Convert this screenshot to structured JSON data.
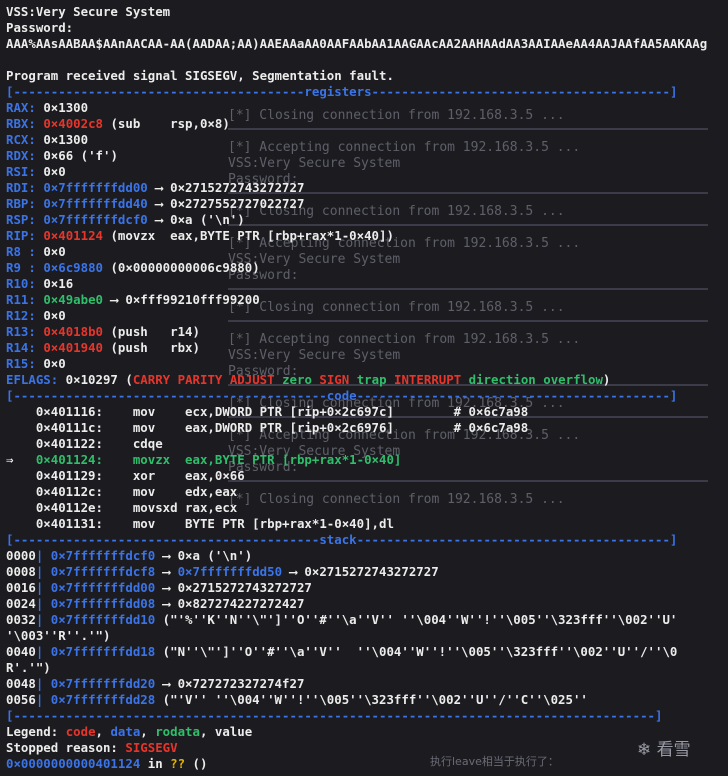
{
  "header": {
    "title": "VSS:Very Secure System",
    "password_label": "Password:",
    "password_input": "AAA%AAsAABAA$AAnAACAA-AA(AADAA;AA)AAEAAaAA0AAFAAbAA1AAGAAcAA2AAHAAdAA3AAIAAeAA4AAJAAfAA5AAKAAg",
    "signal": "Program received signal SIGSEGV, Segmentation fault."
  },
  "sections": {
    "registers": "registers",
    "code": "code",
    "stack": "stack"
  },
  "registers": [
    {
      "name": "RAX:",
      "value": "0×1300",
      "color": "white",
      "rest": ""
    },
    {
      "name": "RBX:",
      "value": "0×4002c8",
      "color": "red",
      "rest": " (sub    rsp,0×8)"
    },
    {
      "name": "RCX:",
      "value": "0×1300",
      "color": "white",
      "rest": ""
    },
    {
      "name": "RDX:",
      "value": "0×66 ('f')",
      "color": "white",
      "rest": ""
    },
    {
      "name": "RSI:",
      "value": "0×0",
      "color": "white",
      "rest": ""
    },
    {
      "name": "RDI:",
      "value": "0×7fffffffdd00",
      "color": "blue",
      "rest": " ⟶ 0×2715272743272727"
    },
    {
      "name": "RBP:",
      "value": "0×7fffffffdd40",
      "color": "blue",
      "rest": " ⟶ 0×2727552727022727"
    },
    {
      "name": "RSP:",
      "value": "0×7fffffffdcf0",
      "color": "blue",
      "rest": " ⟶ 0×a ('\\n')"
    },
    {
      "name": "RIP:",
      "value": "0×401124",
      "color": "red",
      "rest": " (movzx  eax,BYTE PTR [rbp+rax*1-0×40])"
    },
    {
      "name": "R8 :",
      "value": "0×0",
      "color": "white",
      "rest": ""
    },
    {
      "name": "R9 :",
      "value": "0×6c9880",
      "color": "blue",
      "rest": " (0×00000000006c9880)"
    },
    {
      "name": "R10:",
      "value": "0×16",
      "color": "white",
      "rest": ""
    },
    {
      "name": "R11:",
      "value": "0×49abe0",
      "color": "green",
      "rest": " ⟶ 0×fff99210fff99200"
    },
    {
      "name": "R12:",
      "value": "0×0",
      "color": "white",
      "rest": ""
    },
    {
      "name": "R13:",
      "value": "0×4018b0",
      "color": "red",
      "rest": " (push   r14)"
    },
    {
      "name": "R14:",
      "value": "0×401940",
      "color": "red",
      "rest": " (push   rbx)"
    },
    {
      "name": "R15:",
      "value": "0×0",
      "color": "white",
      "rest": ""
    }
  ],
  "eflags": {
    "label": "EFLAGS:",
    "value": "0×10297",
    "flags": [
      {
        "text": "CARRY",
        "color": "red"
      },
      {
        "text": "PARITY",
        "color": "red"
      },
      {
        "text": "ADJUST",
        "color": "red"
      },
      {
        "text": "zero",
        "color": "green"
      },
      {
        "text": "SIGN",
        "color": "red"
      },
      {
        "text": "trap",
        "color": "green"
      },
      {
        "text": "INTERRUPT",
        "color": "red"
      },
      {
        "text": "direction",
        "color": "green"
      },
      {
        "text": "overflow",
        "color": "green"
      }
    ]
  },
  "code": [
    {
      "marker": "  ",
      "addr": "0×401116:",
      "op": "mov   ",
      "args": "ecx,DWORD PTR [rip+0×2c697c]",
      "comment": "        # 0×6c7a98",
      "current": false
    },
    {
      "marker": "  ",
      "addr": "0×40111c:",
      "op": "mov   ",
      "args": "eax,DWORD PTR [rip+0×2c6976]",
      "comment": "        # 0×6c7a98",
      "current": false
    },
    {
      "marker": "  ",
      "addr": "0×401122:",
      "op": "cdqe  ",
      "args": "",
      "comment": "",
      "current": false
    },
    {
      "marker": "⇒ ",
      "addr": "0×401124:",
      "op": "movzx ",
      "args": "eax,BYTE PTR [rbp+rax*1-0×40]",
      "comment": "",
      "current": true
    },
    {
      "marker": "  ",
      "addr": "0×401129:",
      "op": "xor   ",
      "args": "eax,0×66",
      "comment": "",
      "current": false
    },
    {
      "marker": "  ",
      "addr": "0×40112c:",
      "op": "mov   ",
      "args": "edx,eax",
      "comment": "",
      "current": false
    },
    {
      "marker": "  ",
      "addr": "0×40112e:",
      "op": "movsxd",
      "args": "rax,ecx",
      "comment": "",
      "current": false
    },
    {
      "marker": "  ",
      "addr": "0×401131:",
      "op": "mov   ",
      "args": "BYTE PTR [rbp+rax*1-0×40],dl",
      "comment": "",
      "current": false
    }
  ],
  "stack": [
    {
      "off": "0000",
      "addr": "0×7fffffffdcf0",
      "rest": " ⟶ 0×a ('\\n')",
      "blue2": ""
    },
    {
      "off": "0008",
      "addr": "0×7fffffffdcf8",
      "rest": " ⟶ ",
      "blue2": "0×7fffffffdd50",
      "rest2": " ⟶ 0×2715272743272727"
    },
    {
      "off": "0016",
      "addr": "0×7fffffffdd00",
      "rest": " ⟶ 0×2715272743272727",
      "blue2": ""
    },
    {
      "off": "0024",
      "addr": "0×7fffffffdd08",
      "rest": " ⟶ 0×827274227272427",
      "blue2": ""
    },
    {
      "off": "0032",
      "addr": "0×7fffffffdd10",
      "rest": " (\"'%''K''N''\\\"']''O''#''\\a''V'' ''\\004''W''!''\\005''\\323fff''\\002''U'",
      "blue2": ""
    },
    {
      "off": "    ",
      "addr": "",
      "rest": "'\\003''R''.'\")",
      "blue2": "",
      "cont": true
    },
    {
      "off": "0040",
      "addr": "0×7fffffffdd18",
      "rest": " (\"N''\\\"']''O''#''\\a''V''  ''\\004''W''!''\\005''\\323fff''\\002''U''/''\\0",
      "blue2": ""
    },
    {
      "off": "    ",
      "addr": "",
      "rest": "R'.'\")",
      "blue2": "",
      "cont": true
    },
    {
      "off": "0048",
      "addr": "0×7fffffffdd20",
      "rest": " ⟶ 0×727272327274f27",
      "blue2": ""
    },
    {
      "off": "0056",
      "addr": "0×7fffffffdd28",
      "rest": " (\"'V'' ''\\004''W''!''\\005''\\323fff''\\002''U''/''C''\\025''",
      "blue2": ""
    }
  ],
  "legend": {
    "label": "Legend:",
    "items": [
      {
        "text": "code",
        "color": "red"
      },
      {
        "text": "data",
        "color": "blue"
      },
      {
        "text": "rodata",
        "color": "green"
      },
      {
        "text": "value",
        "color": "white"
      }
    ]
  },
  "stopped": {
    "label": "Stopped reason:",
    "value": "SIGSEGV"
  },
  "last": {
    "addr": "0×0000000000401124",
    "mid": " in ",
    "q": "??",
    "end": " ()"
  },
  "background_terminal": [
    "[*] Closing connection from 192.168.3.5 ...",
    "[*] Accepting connection from 192.168.3.5 ...",
    "VSS:Very Secure System",
    "Password:",
    "[*] Closing connection from 192.168.3.5 ...",
    "[*] Accepting connection from 192.168.3.5 ...",
    "VSS:Very Secure System",
    "Password:",
    "[*] Closing connection from 192.168.3.5 ...",
    "[*] Accepting connection from 192.168.3.5 ...",
    "VSS:Very Secure System",
    "Password:",
    "[*] Closing connection from 192.168.3.5 ...",
    "[*] Accepting connection from 192.168.3.5 ...",
    "VSS:Very Secure System",
    "Password:",
    "[*] Closing connection from 192.168.3.5 ..."
  ],
  "watermark": "❄ 看雪",
  "bottom_caption": "执行leave相当于执行了："
}
